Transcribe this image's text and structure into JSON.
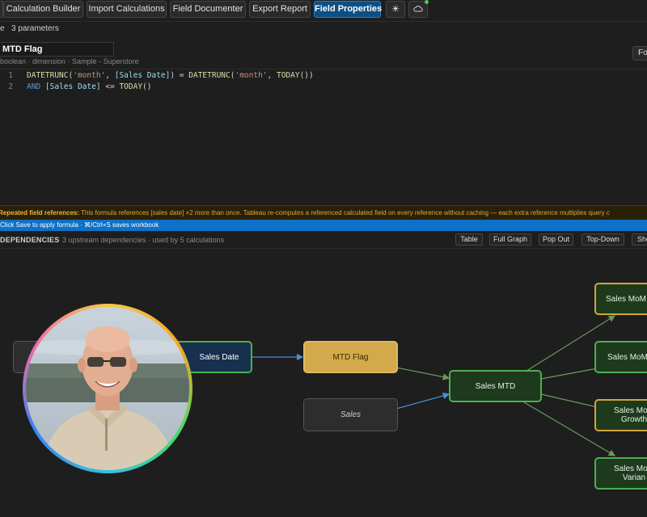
{
  "toolbar": {
    "buttons": [
      {
        "label": "Calculation Builder",
        "active": false
      },
      {
        "label": "Import Calculations",
        "active": false
      },
      {
        "label": "Field Documenter",
        "active": false
      },
      {
        "label": "Export Report",
        "active": false
      },
      {
        "label": "Field Properties",
        "active": true
      }
    ],
    "theme_icon": "☀",
    "cloud_icon": "☁"
  },
  "subbar": {
    "prefix": "e",
    "params": "3 parameters"
  },
  "field": {
    "name": "MTD Flag",
    "meta": "boolean · dimension · Sample - Superstore",
    "format_button": "Fo"
  },
  "editor": {
    "lines": [
      {
        "no": "1"
      },
      {
        "no": "2"
      }
    ]
  },
  "warning": {
    "label": "Repeated field references:",
    "text": "This formula references [sales date] ×2 more than once. Tableau re-computes a referenced calculated field on every reference without caching — each extra reference multiplies query c"
  },
  "savebar": {
    "text": "Click Save to apply formula · ⌘/Ctrl+S saves workbook"
  },
  "dependencies": {
    "title": "DEPENDENCIES",
    "subtitle": "3 upstream dependencies · used by 5 calculations",
    "buttons": [
      "Table",
      "Full Graph",
      "Pop Out",
      "Top-Down",
      "She"
    ]
  },
  "graph": {
    "nodes": [
      {
        "id": "n-sales-date",
        "label": "Sales Date"
      },
      {
        "id": "n-mtd-flag",
        "label": "MTD Flag"
      },
      {
        "id": "n-sales",
        "label": "Sales"
      },
      {
        "id": "n-sales-mtd",
        "label": "Sales MTD"
      },
      {
        "id": "n-mom-c",
        "label": "Sales MoM C"
      },
      {
        "id": "n-mom-v",
        "label": "Sales MoM V"
      },
      {
        "id": "n-mom-growth",
        "label": "Sales MoM\nGrowth"
      },
      {
        "id": "n-mom-varian",
        "label": "Sales MoM\nVarian"
      }
    ]
  },
  "colors": {
    "accent": "#0b4f85",
    "calc_border": "#4caf50",
    "gold": "#d4a94c",
    "warning": "#e0a638",
    "save_bar": "#0e70c6"
  }
}
